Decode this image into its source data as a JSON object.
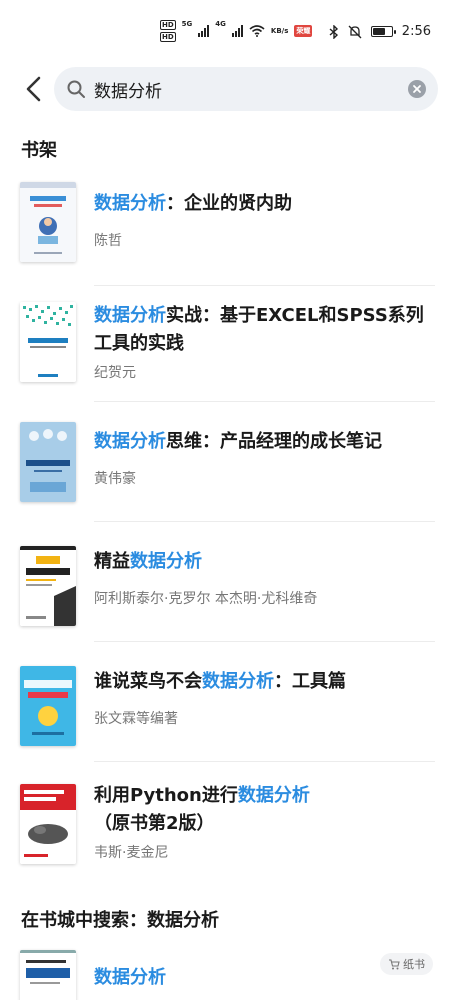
{
  "status_bar": {
    "hd1": "HD",
    "hd2": "HD",
    "net1": "5G",
    "net2": "4G",
    "speed": "KB/s",
    "app_badge": "荣耀",
    "time": "2:56",
    "battery_level": 0.7
  },
  "search": {
    "query": "数据分析",
    "placeholder": ""
  },
  "bookshelf": {
    "title": "书架",
    "books": [
      {
        "title_hl": "数据分析",
        "title_rest": "：企业的贤内助",
        "title_pre": "",
        "author": "陈哲"
      },
      {
        "title_hl": "数据分析",
        "title_rest": "实战：基于EXCEL和SPSS系列工具的实践",
        "title_pre": "",
        "author": "纪贺元"
      },
      {
        "title_hl": "数据分析",
        "title_rest": "思维：产品经理的成长笔记",
        "title_pre": "",
        "author": "黄伟豪"
      },
      {
        "title_pre": "精益",
        "title_hl": "数据分析",
        "title_rest": "",
        "author": "阿利斯泰尔·克罗尔 本杰明·尤科维奇"
      },
      {
        "title_pre": "谁说菜鸟不会",
        "title_hl": "数据分析",
        "title_rest": "：工具篇",
        "author": "张文霖等编著"
      },
      {
        "title_pre": "利用Python进行",
        "title_hl": "数据分析",
        "title_rest": "（原书第2版）",
        "author": "韦斯·麦金尼"
      }
    ]
  },
  "store_search": {
    "title": "在书城中搜索：数据分析",
    "first_result": {
      "title_pre": "",
      "title_hl": "数据分析",
      "title_rest": "",
      "tag": "纸书"
    }
  },
  "colors": {
    "highlight": "#2b8ce0"
  }
}
